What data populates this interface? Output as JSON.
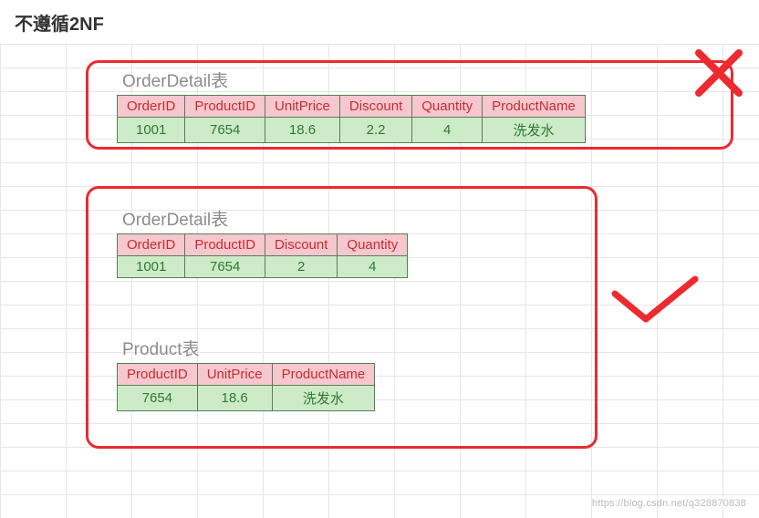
{
  "title": "不遵循2NF",
  "watermark": "https://blog.csdn.net/q328870838",
  "table1": {
    "caption": "OrderDetail表",
    "headers": [
      "OrderID",
      "ProductID",
      "UnitPrice",
      "Discount",
      "Quantity",
      "ProductName"
    ],
    "row": [
      "1001",
      "7654",
      "18.6",
      "2.2",
      "4",
      "洗发水"
    ]
  },
  "table2": {
    "caption": "OrderDetail表",
    "headers": [
      "OrderID",
      "ProductID",
      "Discount",
      "Quantity"
    ],
    "row": [
      "1001",
      "7654",
      "2",
      "4"
    ]
  },
  "table3": {
    "caption": "Product表",
    "headers": [
      "ProductID",
      "UnitPrice",
      "ProductName"
    ],
    "row": [
      "7654",
      "18.6",
      "洗发水"
    ]
  }
}
